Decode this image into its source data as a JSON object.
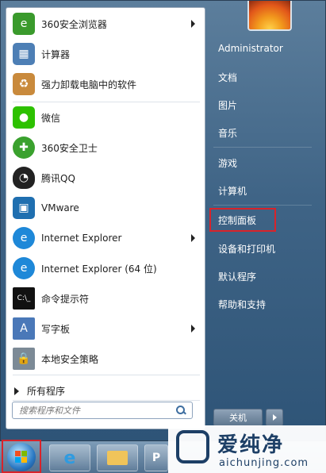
{
  "programs": [
    {
      "label": "360安全浏览器",
      "icon": "browser-360-icon",
      "color": "#3a9a2c",
      "arrow": true
    },
    {
      "label": "计算器",
      "icon": "calculator-icon",
      "color": "#4d7fb5",
      "arrow": false
    },
    {
      "label": "强力卸载电脑中的软件",
      "icon": "uninstall-box-icon",
      "color": "#c98a3c",
      "arrow": false
    },
    {
      "label": "微信",
      "icon": "wechat-icon",
      "color": "#2dc100",
      "arrow": false
    },
    {
      "label": "360安全卫士",
      "icon": "security-360-icon",
      "color": "#3aa12e",
      "arrow": false
    },
    {
      "label": "腾讯QQ",
      "icon": "qq-penguin-icon",
      "color": "#222222",
      "arrow": false
    },
    {
      "label": "VMware",
      "icon": "vmware-icon",
      "color": "#1f6fb0",
      "arrow": false
    },
    {
      "label": "Internet Explorer",
      "icon": "ie-icon",
      "color": "#1e88d8",
      "arrow": true
    },
    {
      "label": "Internet Explorer (64 位)",
      "icon": "ie-icon",
      "color": "#1e88d8",
      "arrow": false
    },
    {
      "label": "命令提示符",
      "icon": "command-prompt-icon",
      "color": "#111111",
      "arrow": false
    },
    {
      "label": "写字板",
      "icon": "wordpad-icon",
      "color": "#4a78b8",
      "arrow": true
    },
    {
      "label": "本地安全策略",
      "icon": "security-policy-icon",
      "color": "#7c8a96",
      "arrow": false
    }
  ],
  "all_programs": "所有程序",
  "search_placeholder": "搜索程序和文件",
  "right": [
    {
      "label": "Administrator"
    },
    {
      "label": "文档"
    },
    {
      "label": "图片"
    },
    {
      "label": "音乐"
    },
    {
      "label": "游戏"
    },
    {
      "label": "计算机"
    },
    {
      "label": "控制面板"
    },
    {
      "label": "设备和打印机"
    },
    {
      "label": "默认程序"
    },
    {
      "label": "帮助和支持"
    }
  ],
  "shutdown": "关机",
  "watermark": {
    "cn": "爱纯净",
    "en": "aichunjing.com"
  },
  "highlight_color": "#d8232a"
}
